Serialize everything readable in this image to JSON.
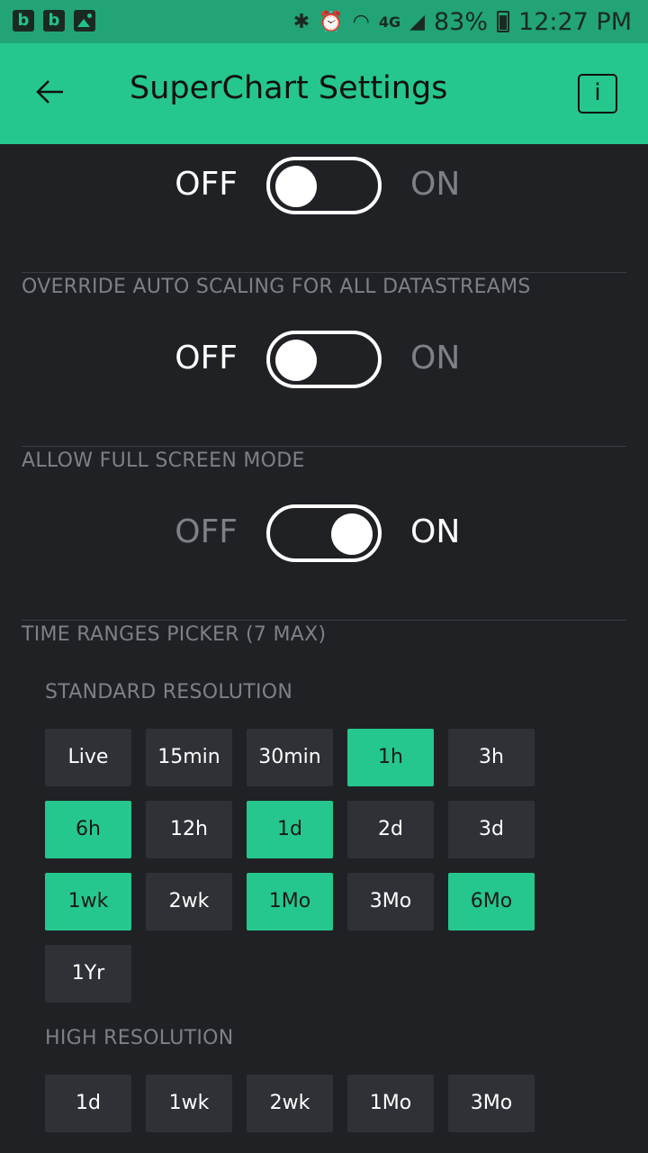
{
  "status_bar": {
    "left_icons": [
      "b",
      "b"
    ],
    "battery": "83%",
    "time": "12:27 PM",
    "network": "4G"
  },
  "appbar": {
    "title": "SuperChart Settings",
    "info_label": "i"
  },
  "toggles": [
    {
      "off_label": "OFF",
      "on_label": "ON",
      "state": "off"
    },
    {
      "section": "OVERRIDE AUTO SCALING FOR ALL DATASTREAMS",
      "off_label": "OFF",
      "on_label": "ON",
      "state": "off"
    },
    {
      "section": "ALLOW FULL SCREEN MODE",
      "off_label": "OFF",
      "on_label": "ON",
      "state": "on"
    }
  ],
  "time_ranges": {
    "section": "TIME RANGES PICKER (7 MAX)",
    "standard_label": "STANDARD RESOLUTION",
    "standard": [
      "Live",
      "15min",
      "30min",
      "1h",
      "3h",
      "6h",
      "12h",
      "1d",
      "2d",
      "3d",
      "1wk",
      "2wk",
      "1Mo",
      "3Mo",
      "6Mo",
      "1Yr"
    ],
    "standard_selected": [
      false,
      false,
      false,
      true,
      false,
      true,
      false,
      true,
      false,
      false,
      true,
      false,
      true,
      false,
      true,
      false
    ],
    "high_label": "HIGH RESOLUTION",
    "high": [
      "1d",
      "1wk",
      "2wk",
      "1Mo",
      "3Mo"
    ],
    "high_selected": [
      false,
      false,
      false,
      false,
      false
    ]
  },
  "colors": {
    "accent": "#25c78c",
    "background": "#1f2125",
    "chip": "#2e3136"
  }
}
